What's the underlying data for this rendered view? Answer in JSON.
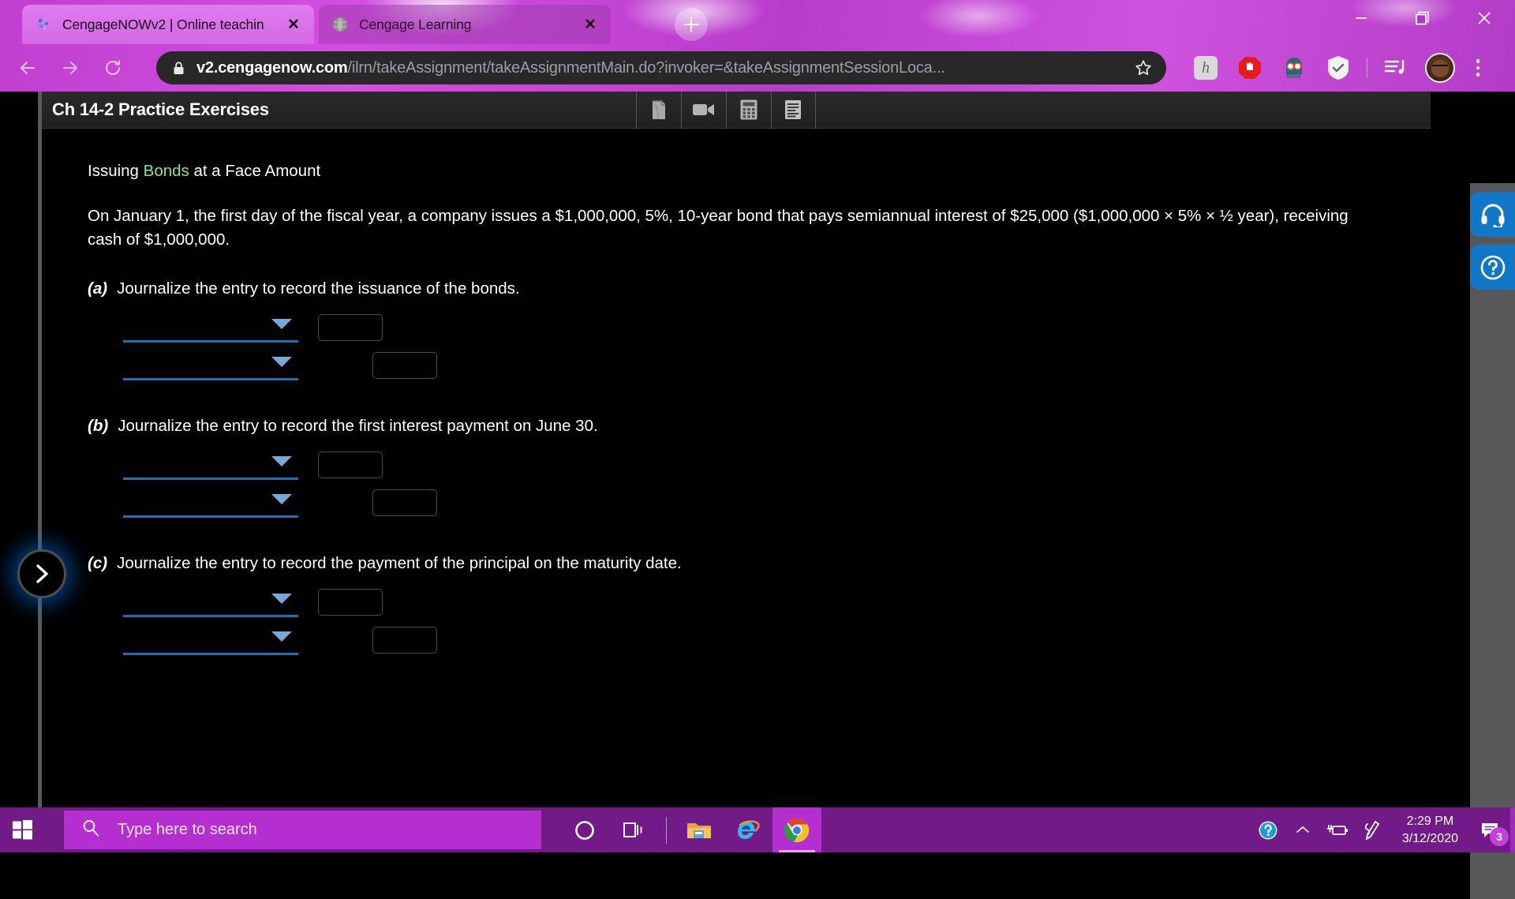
{
  "browser": {
    "tabs": [
      {
        "title": "CengageNOWv2 | Online teachin",
        "favicon": "cengage-now-icon",
        "active": true,
        "close_label": "✕"
      },
      {
        "title": "Cengage Learning",
        "favicon": "cengage-globe-icon",
        "active": false,
        "close_label": "✕"
      }
    ],
    "new_tab_label": "New tab",
    "window_controls": {
      "minimize": "Minimize",
      "maximize": "Restore",
      "close": "Close"
    },
    "nav": {
      "back": "Back",
      "forward": "Forward",
      "reload": "Reload"
    },
    "omnibox": {
      "host": "v2.cengagenow.com",
      "path": "/ilrn/takeAssignment/takeAssignmentMain.do?invoker=&takeAssignmentSessionLoca...",
      "secure": true,
      "bookmark_label": "Bookmark this tab"
    },
    "extensions": [
      {
        "name": "honey-extension-icon",
        "glyph": "h"
      },
      {
        "name": "adblock-extension-icon",
        "glyph": "✋"
      },
      {
        "name": "grammarly-character-extension-icon",
        "glyph": ""
      },
      {
        "name": "shield-checkmark-extension-icon",
        "glyph": "✓"
      },
      {
        "name": "media-playlist-icon",
        "glyph": "♪"
      }
    ],
    "profile_label": "Profile",
    "menu_label": "Customize and control Google Chrome"
  },
  "app": {
    "title": "Ch 14-2 Practice Exercises",
    "toolbar": [
      {
        "name": "ebook-icon",
        "label": "eBook"
      },
      {
        "name": "video-icon",
        "label": "Video"
      },
      {
        "name": "calculator-icon",
        "label": "Calculator"
      },
      {
        "name": "notes-icon",
        "label": "Notes"
      }
    ],
    "collapse_label": "›",
    "side_buttons": [
      {
        "name": "support-headset-icon",
        "label": "Support"
      },
      {
        "name": "help-question-icon",
        "label": "Help"
      }
    ]
  },
  "exercise": {
    "heading_prefix": "Issuing ",
    "heading_glossary": "Bonds",
    "heading_suffix": " at a Face Amount",
    "body": "On January 1, the first day of the fiscal year, a company issues a $1,000,000, 5%, 10-year bond that pays semiannual interest of $25,000 ($1,000,000 × 5% × ½ year), receiving cash of $1,000,000.",
    "parts": [
      {
        "letter": "(a)",
        "prompt": "Journalize the entry to record the issuance of the bonds.",
        "rows": [
          {
            "account": "",
            "account_placeholder": "",
            "debit": "",
            "credit": null
          },
          {
            "account": "",
            "account_placeholder": "",
            "debit": null,
            "credit": ""
          }
        ]
      },
      {
        "letter": "(b)",
        "prompt": "Journalize the entry to record the first interest payment on June 30.",
        "rows": [
          {
            "account": "",
            "account_placeholder": "",
            "debit": "",
            "credit": null
          },
          {
            "account": "",
            "account_placeholder": "",
            "debit": null,
            "credit": ""
          }
        ]
      },
      {
        "letter": "(c)",
        "prompt": "Journalize the entry to record the payment of the principal on the maturity date.",
        "rows": [
          {
            "account": "",
            "account_placeholder": "",
            "debit": "",
            "credit": null
          },
          {
            "account": "",
            "account_placeholder": "",
            "debit": null,
            "credit": ""
          }
        ]
      }
    ]
  },
  "taskbar": {
    "start_label": "Start",
    "search_placeholder": "Type here to search",
    "items": [
      {
        "name": "cortana-icon",
        "label": "Cortana"
      },
      {
        "name": "task-view-icon",
        "label": "Task View"
      },
      {
        "name": "file-explorer-icon",
        "label": "File Explorer"
      },
      {
        "name": "internet-explorer-icon",
        "label": "Internet Explorer"
      },
      {
        "name": "google-chrome-icon",
        "label": "Google Chrome"
      }
    ],
    "tray": [
      {
        "name": "help-tray-icon",
        "label": "Get Help"
      },
      {
        "name": "show-hidden-icons-icon",
        "label": "Show hidden icons"
      },
      {
        "name": "battery-charging-icon",
        "label": "Battery"
      },
      {
        "name": "pen-workspace-icon",
        "label": "Windows Ink Workspace"
      }
    ],
    "time": "2:29 PM",
    "date": "3/12/2020",
    "notification_count": "3",
    "notification_label": "Notifications"
  },
  "colors": {
    "accent_purple": "#b52fd0",
    "taskbar_purple": "#721a87",
    "glossary_green": "#84e39a",
    "select_blue": "#1f6fb2",
    "caret_blue": "#76a9d8",
    "help_blue": "#1377c8"
  }
}
